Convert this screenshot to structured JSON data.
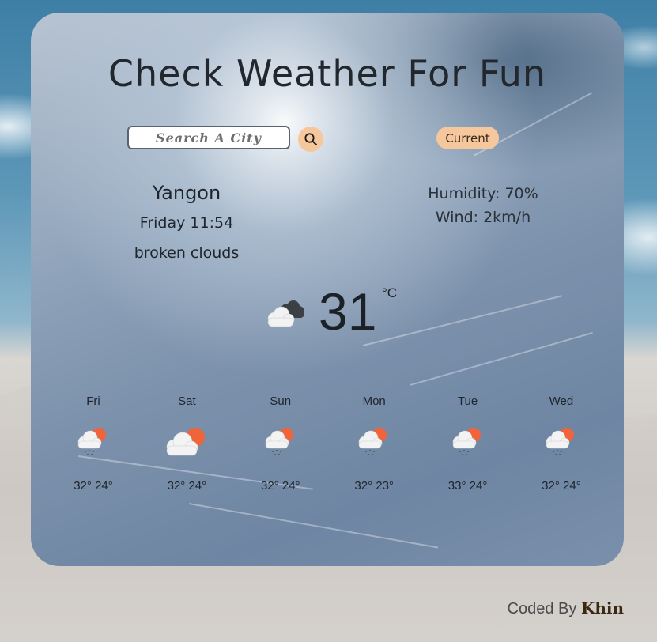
{
  "app": {
    "title": "Check Weather For Fun"
  },
  "search": {
    "placeholder": "Search A City",
    "current_label": "Current"
  },
  "current": {
    "city": "Yangon",
    "datetime": "Friday 11:54",
    "description": "broken clouds",
    "humidity": "Humidity: 70%",
    "wind": "Wind: 2km/h",
    "temperature": "31",
    "unit": "°C",
    "icon": "broken-clouds-icon"
  },
  "forecast": [
    {
      "day": "Fri",
      "temps": "32° 24°",
      "icon": "rain-sun-cloud-icon"
    },
    {
      "day": "Sat",
      "temps": "32° 24°",
      "icon": "partly-cloudy-icon"
    },
    {
      "day": "Sun",
      "temps": "32° 24°",
      "icon": "rain-sun-cloud-icon"
    },
    {
      "day": "Mon",
      "temps": "32° 23°",
      "icon": "rain-sun-cloud-icon"
    },
    {
      "day": "Tue",
      "temps": "33° 24°",
      "icon": "rain-sun-cloud-icon"
    },
    {
      "day": "Wed",
      "temps": "32° 24°",
      "icon": "rain-sun-cloud-icon"
    }
  ],
  "footer": {
    "prefix": "Coded By",
    "author": "Khin"
  },
  "colors": {
    "accent": "#f6c79c",
    "sun": "#f0643c",
    "text": "#1f252c"
  }
}
